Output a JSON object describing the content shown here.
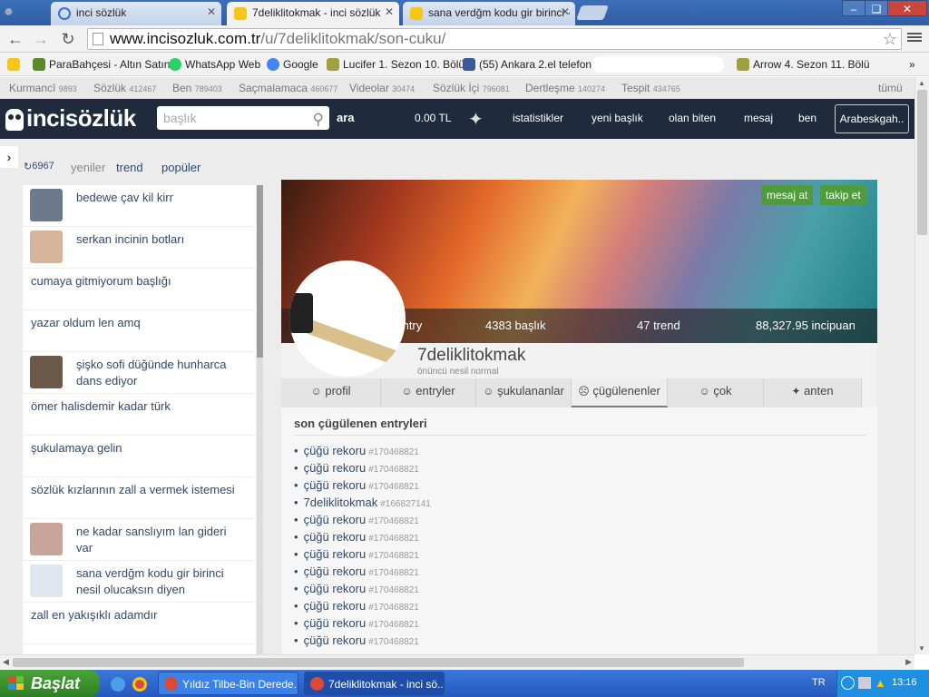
{
  "browser": {
    "tabs": [
      {
        "title": "inci sözlük",
        "icon_color": "#3a6fd8"
      },
      {
        "title": "7deliklitokmak - inci sözlük",
        "icon_color": "#f5c518"
      },
      {
        "title": "sana verdğm kodu gir birinci ·",
        "icon_color": "#f5c518"
      }
    ],
    "url_host": "www.incisozluk.com.tr",
    "url_path": "/u/7deliklitokmak/son-cuku/",
    "bookmarks": [
      {
        "label": "ParaBahçesi - Altın Satın",
        "icon_color": "#5a8a2a"
      },
      {
        "label": "WhatsApp Web",
        "icon_color": "#25d366"
      },
      {
        "label": "Google",
        "icon_color": "#4285f4"
      },
      {
        "label": "Lucifer 1. Sezon 10. Bölü",
        "icon_color": "#a0a040"
      },
      {
        "label": "(55) Ankara 2.el telefon",
        "icon_color": "#3b5998"
      },
      {
        "label": "Arrow 4. Sezon 11. Bölü",
        "icon_color": "#a0a040"
      }
    ],
    "more_label": "»"
  },
  "site": {
    "categories": [
      {
        "name": "Kurmancî",
        "count": "9893"
      },
      {
        "name": "Sözlük",
        "count": "412467"
      },
      {
        "name": "Ben",
        "count": "789403"
      },
      {
        "name": "Saçmalamaca",
        "count": "460677"
      },
      {
        "name": "Videolar",
        "count": "30474"
      },
      {
        "name": "Sözlük İçi",
        "count": "796081"
      },
      {
        "name": "Dertleşme",
        "count": "140274"
      },
      {
        "name": "Tespit",
        "count": "434765"
      }
    ],
    "all_label": "tümü",
    "logo": "incisözlük",
    "search_placeholder": "başlık",
    "search_button": "ara",
    "balance": "0.00 TL",
    "nav": [
      "istatistikler",
      "yeni başlık",
      "olan biten",
      "mesaj",
      "ben"
    ],
    "topic_box": "Arabeskgah..",
    "left_tabs": {
      "count": "6967",
      "new": "yeniler",
      "trend": "trend",
      "popular": "popüler"
    },
    "left_items": [
      {
        "text": "bedewe çav kil kirr",
        "thumb": true,
        "thumb_color": "#6d7a8c"
      },
      {
        "text": "serkan incinin botları",
        "thumb": true,
        "thumb_color": "#d7b59a"
      },
      {
        "text": "cumaya gitmiyorum başlığı",
        "thumb": false
      },
      {
        "text": "yazar oldum len amq",
        "thumb": false
      },
      {
        "text": "şişko sofi düğünde hunharca dans ediyor",
        "thumb": true,
        "thumb_color": "#6b5a4a"
      },
      {
        "text": "ömer halisdemir kadar türk",
        "thumb": false
      },
      {
        "text": "şukulamaya gelin",
        "thumb": false
      },
      {
        "text": "sözlük kızlarının zall a vermek istemesi",
        "thumb": false
      },
      {
        "text": "ne kadar sanslıyım lan gideri var",
        "thumb": true,
        "thumb_color": "#c9a49a"
      },
      {
        "text": "sana verdğm kodu gir birinci nesil olucaksın diyen",
        "thumb": true,
        "thumb_color": "#e0e6ee"
      },
      {
        "text": "zall en yakışıklı adamdır",
        "thumb": false
      }
    ],
    "profile": {
      "buttons": [
        "mesaj at",
        "takip et"
      ],
      "stats": {
        "entries": "7 / 330 / 20953 entry",
        "topics": "4383 başlık",
        "trend": "47 trend",
        "points": "88,327.95 incipuan"
      },
      "username": "7deliklitokmak",
      "subtitle": "önüncü nesil normal",
      "tabs": [
        "profil",
        "entryler",
        "şukulananlar",
        "çügülenenler",
        "çok",
        "anten"
      ],
      "list_title": "son çügülenen entryleri",
      "entries": [
        {
          "title": "çüğü rekoru",
          "id": "#170468821"
        },
        {
          "title": "çüğü rekoru",
          "id": "#170468821"
        },
        {
          "title": "çüğü rekoru",
          "id": "#170468821"
        },
        {
          "title": "7deliklitokmak",
          "id": "#166827141"
        },
        {
          "title": "çüğü rekoru",
          "id": "#170468821"
        },
        {
          "title": "çüğü rekoru",
          "id": "#170468821"
        },
        {
          "title": "çüğü rekoru",
          "id": "#170468821"
        },
        {
          "title": "çüğü rekoru",
          "id": "#170468821"
        },
        {
          "title": "çüğü rekoru",
          "id": "#170468821"
        },
        {
          "title": "çüğü rekoru",
          "id": "#170468821"
        },
        {
          "title": "çüğü rekoru",
          "id": "#170468821"
        },
        {
          "title": "çüğü rekoru",
          "id": "#170468821"
        }
      ]
    }
  },
  "taskbar": {
    "start": "Başlat",
    "windows": [
      "Yıldız Tilbe-Bin Derede...",
      "7deliklitokmak - inci sö..."
    ],
    "lang": "TR",
    "clock": "13:16"
  }
}
